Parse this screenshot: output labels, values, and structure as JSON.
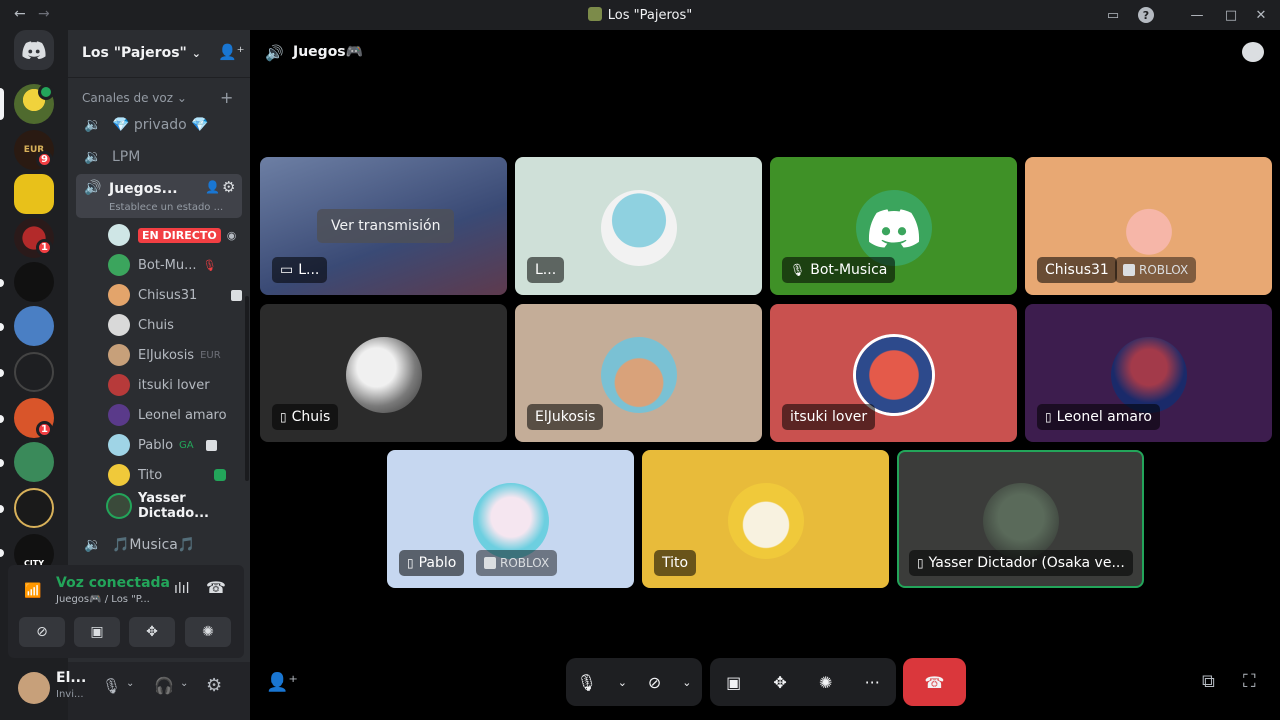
{
  "window": {
    "title": "Los \"Pajeros\""
  },
  "server": {
    "name": "Los \"Pajeros\"",
    "badges": [
      "9",
      "1",
      "1"
    ]
  },
  "sidebar": {
    "section_label": "Canales de voz",
    "channels": [
      {
        "name": "💎 privado 💎"
      },
      {
        "name": "LPM"
      },
      {
        "name": "Juegos...",
        "status": "Establece un estado ..."
      },
      {
        "name": "🎵Musica🎵"
      }
    ],
    "live_badge": "EN DIRECTO",
    "members": [
      {
        "name": ""
      },
      {
        "name": "Bot-Mu..."
      },
      {
        "name": "Chisus31"
      },
      {
        "name": "Chuis"
      },
      {
        "name": "ElJukosis",
        "extra": "EUR"
      },
      {
        "name": "itsuki lover"
      },
      {
        "name": "Leonel amaro"
      },
      {
        "name": "Pablo",
        "extra": "GA"
      },
      {
        "name": "Tito"
      },
      {
        "name": "Yasser Dictado..."
      }
    ]
  },
  "voice": {
    "status": "Voz conectada",
    "location": "Juegos🎮 / Los \"P..."
  },
  "user": {
    "name": "El...",
    "status": "Invi..."
  },
  "header": {
    "channel": "Juegos🎮"
  },
  "stream": {
    "button": "Ver transmisión",
    "label": "L..."
  },
  "tiles": [
    {
      "name": "L..."
    },
    {
      "name": "Bot-Musica"
    },
    {
      "name": "Chisus31",
      "activity": "ROBLOX"
    },
    {
      "name": "Chuis"
    },
    {
      "name": "ElJukosis"
    },
    {
      "name": "itsuki lover"
    },
    {
      "name": "Leonel amaro"
    },
    {
      "name": "Pablo",
      "activity": "ROBLOX"
    },
    {
      "name": "Tito"
    },
    {
      "name": "Yasser Dictador (Osaka ve..."
    }
  ],
  "colors": {
    "accent": "#5865f2",
    "connected": "#23a55a",
    "danger": "#da373c",
    "live": "#f23f43"
  }
}
